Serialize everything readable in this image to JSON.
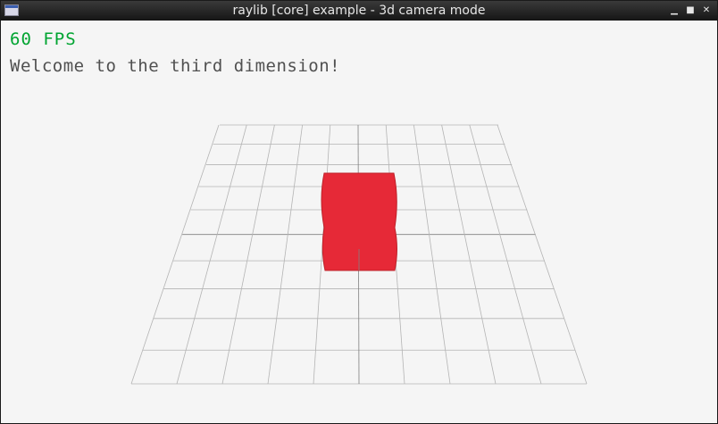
{
  "window": {
    "title": "raylib [core] example - 3d camera mode",
    "icon": "raylib-window-icon",
    "controls": {
      "minimize": "▁",
      "maximize": "■",
      "close": "✕"
    }
  },
  "overlay": {
    "fps_text": "60 FPS",
    "welcome_text": "Welcome to the third dimension!",
    "fps_color": "#00a431",
    "text_color": "#505050"
  },
  "scene": {
    "background": "#f5f5f5",
    "grid_slices": 10,
    "grid_color": "#b4b4b4",
    "axis_color": "#808080",
    "cube_color": "#e62937",
    "cube_edge_color": "#be2129"
  }
}
